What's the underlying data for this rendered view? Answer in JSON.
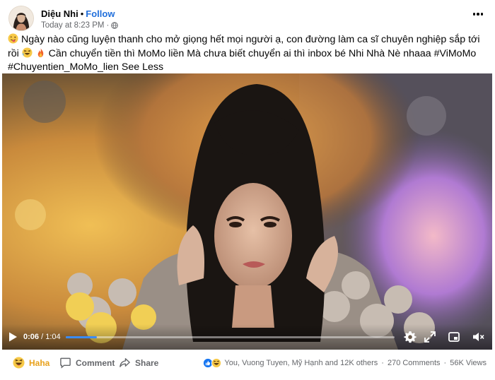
{
  "post": {
    "author": "Diệu Nhi",
    "separator": "•",
    "follow_label": "Follow",
    "timestamp": "Today at 8:23 PM",
    "meta_separator": "·",
    "caption": {
      "part1": " Ngày nào cũng luyện thanh cho mở giọng hết mọi người ạ, con đường làm ca sĩ chuyên nghiệp sắp tới rồi ",
      "part2": " Cần chuyển tiền thì MoMo liền Mà chưa biết chuyển ai thì inbox bé Nhi Nhà Nè nhaaa #ViMoMo #Chuyentien_MoMo_lien ",
      "see_less": "See Less"
    }
  },
  "video": {
    "current_time": "0:06",
    "time_separator": " / ",
    "duration": "1:04",
    "progress": 0.094,
    "accent": "#3a8bf7"
  },
  "actions": {
    "haha_label": "Haha",
    "comment_label": "Comment",
    "share_label": "Share"
  },
  "stats": {
    "reactors": "You, Vuong Tuyen, Mỹ Hạnh and 12K others",
    "comments": "270 Comments",
    "views": "56K Views",
    "sep": "·"
  },
  "icons": {
    "globe": "globe-icon",
    "more": "more-options-icon",
    "play": "play-icon",
    "settings": "gear-icon",
    "expand": "expand-icon",
    "pip": "picture-in-picture-icon",
    "mute": "speaker-muted-icon",
    "comment": "comment-icon",
    "share": "share-icon"
  },
  "colors": {
    "link_blue": "#216fdb",
    "haha_yellow": "#e8a11b",
    "secondary_text": "#65676b"
  }
}
